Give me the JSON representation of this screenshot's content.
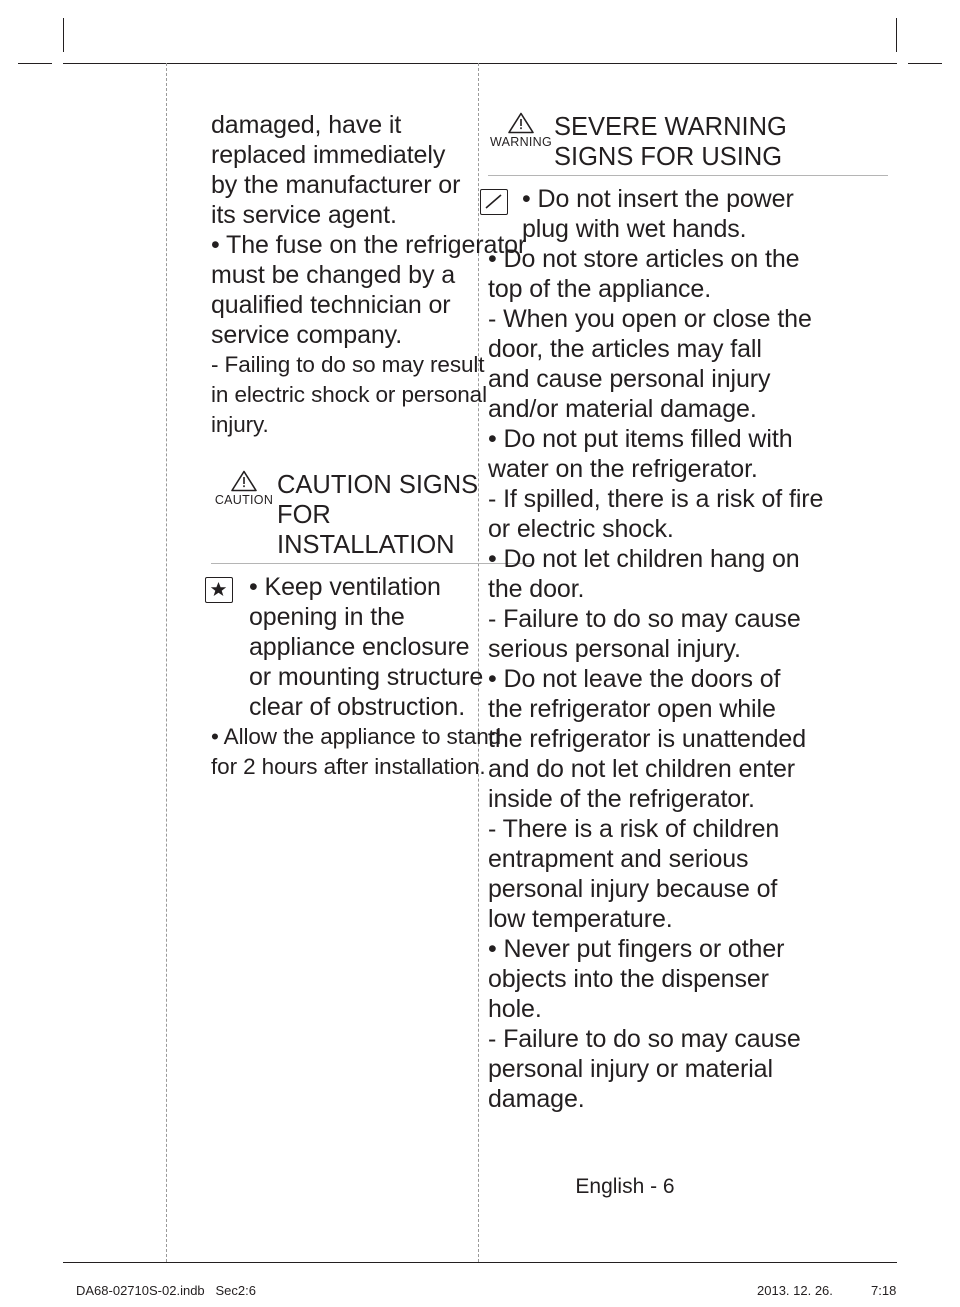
{
  "page": {
    "page_label": "English - 6"
  },
  "left_column": {
    "continued_lines": [
      "damaged, have it",
      "replaced immediately",
      "by the manufacturer or",
      "its service agent."
    ],
    "bullet_fuse": [
      "• The fuse on the refrigerator",
      "must be changed by a",
      "qualified technician or",
      "service company."
    ],
    "dash_failing": [
      "- Failing to do so may result",
      "in electric shock or personal",
      "injury."
    ],
    "caution_section": {
      "sign_word": "CAUTION",
      "icon": "warning-triangle-icon",
      "title_line1": "CAUTION SIGNS FOR",
      "title_line2": "INSTALLATION",
      "glyph": "star-in-box-icon",
      "bullet_ventilation": [
        "• Keep ventilation",
        "opening in the",
        "appliance enclosure",
        "or mounting structure",
        "clear of obstruction."
      ],
      "bullet_allow": [
        "• Allow the appliance to stand",
        "for 2 hours after installation."
      ]
    }
  },
  "right_column": {
    "warning_section": {
      "sign_word": "WARNING",
      "icon": "warning-triangle-icon",
      "title_line1": "SEVERE WARNING",
      "title_line2": "SIGNS FOR USING",
      "glyph": "prohibition-box-icon"
    },
    "items": [
      {
        "lines": [
          "• Do not insert the power",
          "plug with wet hands."
        ]
      },
      {
        "lines": [
          "• Do not store articles on the",
          "top of the appliance."
        ]
      },
      {
        "lines": [
          "- When you open or close the",
          "door, the articles may fall",
          "and cause personal injury",
          "and/or material damage."
        ]
      },
      {
        "lines": [
          "• Do not put items filled with",
          "water on the refrigerator."
        ]
      },
      {
        "lines": [
          "- If spilled, there is a risk of fire",
          "or electric shock."
        ]
      },
      {
        "lines": [
          "• Do not let children hang on",
          "the door."
        ]
      },
      {
        "lines": [
          "- Failure to do so may cause",
          "serious personal injury."
        ]
      },
      {
        "lines": [
          "• Do not leave the doors of",
          "the refrigerator open while",
          "the refrigerator is unattended",
          "and do not let children enter",
          "inside of the refrigerator."
        ]
      },
      {
        "lines": [
          "- There is a risk of children",
          "entrapment and serious",
          "personal injury because of",
          "low temperature."
        ]
      },
      {
        "lines": [
          "• Never put fingers or other",
          "objects into the dispenser",
          "hole."
        ]
      },
      {
        "lines": [
          "- Failure to do so may cause",
          "personal injury or material",
          "damage."
        ]
      }
    ]
  },
  "colophon": {
    "file": "DA68-02710S-02.indb   Sec2:6",
    "date": "2013. 12. 26.",
    "time": "7:18"
  }
}
